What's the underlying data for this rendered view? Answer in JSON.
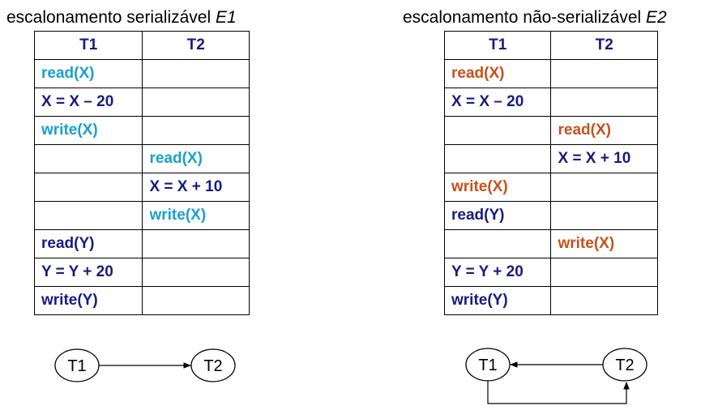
{
  "e1": {
    "title_prefix": "escalonamento serializável ",
    "title_em": "E1",
    "headers": [
      "T1",
      "T2"
    ],
    "rows": [
      {
        "t1": "read(X)",
        "t2": "",
        "c1": "blue",
        "c2": ""
      },
      {
        "t1": "X = X – 20",
        "t2": "",
        "c1": "navy",
        "c2": ""
      },
      {
        "t1": "write(X)",
        "t2": "",
        "c1": "blue",
        "c2": ""
      },
      {
        "t1": "",
        "t2": "read(X)",
        "c1": "",
        "c2": "blue"
      },
      {
        "t1": "",
        "t2": "X = X + 10",
        "c1": "",
        "c2": "navy"
      },
      {
        "t1": "",
        "t2": "write(X)",
        "c1": "",
        "c2": "blue"
      },
      {
        "t1": "read(Y)",
        "t2": "",
        "c1": "navy",
        "c2": ""
      },
      {
        "t1": "Y = Y + 20",
        "t2": "",
        "c1": "navy",
        "c2": ""
      },
      {
        "t1": "write(Y)",
        "t2": "",
        "c1": "navy",
        "c2": ""
      }
    ],
    "graph": {
      "node_a": "T1",
      "node_b": "T2"
    }
  },
  "e2": {
    "title_prefix": "escalonamento não-serializável ",
    "title_em": "E2",
    "headers": [
      "T1",
      "T2"
    ],
    "rows": [
      {
        "t1": "read(X)",
        "t2": "",
        "c1": "red",
        "c2": ""
      },
      {
        "t1": "X = X – 20",
        "t2": "",
        "c1": "navy",
        "c2": ""
      },
      {
        "t1": "",
        "t2": "read(X)",
        "c1": "",
        "c2": "red"
      },
      {
        "t1": "",
        "t2": "X = X + 10",
        "c1": "",
        "c2": "navy"
      },
      {
        "t1": "write(X)",
        "t2": "",
        "c1": "red",
        "c2": ""
      },
      {
        "t1": "read(Y)",
        "t2": "",
        "c1": "navy",
        "c2": ""
      },
      {
        "t1": "",
        "t2": "write(X)",
        "c1": "",
        "c2": "red"
      },
      {
        "t1": "Y = Y + 20",
        "t2": "",
        "c1": "navy",
        "c2": ""
      },
      {
        "t1": "write(Y)",
        "t2": "",
        "c1": "navy",
        "c2": ""
      }
    ],
    "graph": {
      "node_a": "T1",
      "node_b": "T2"
    }
  },
  "colors": {
    "blue": "#1aa0cc",
    "navy": "#1a1a80",
    "red": "#c8501a"
  }
}
